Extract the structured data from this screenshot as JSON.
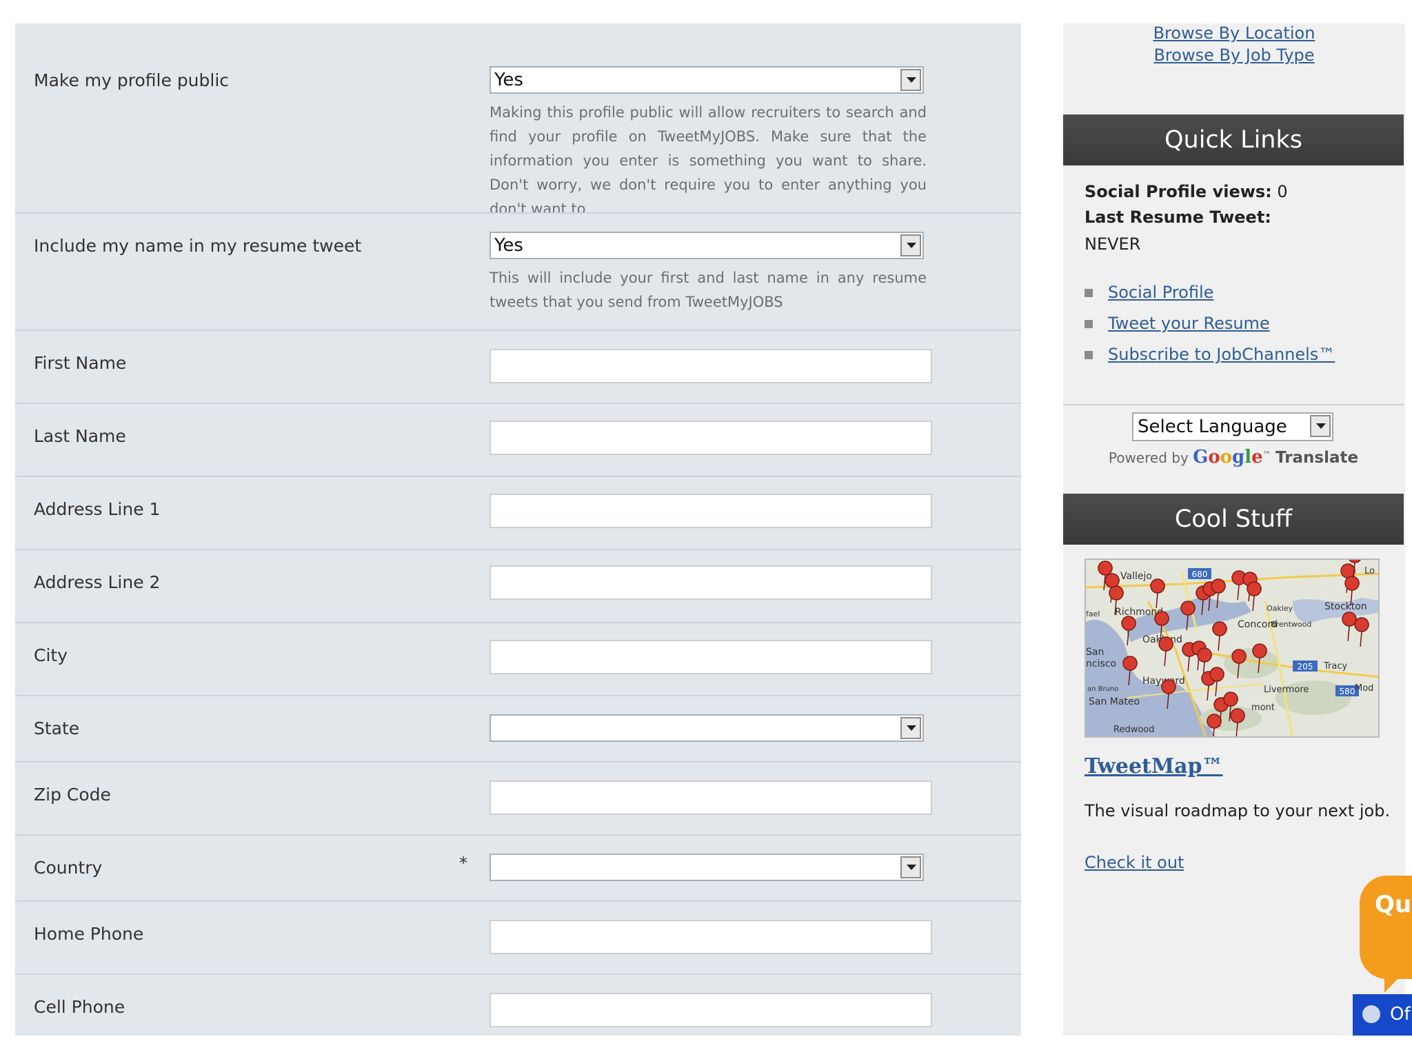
{
  "form": {
    "profile_public": {
      "label": "Make my profile public",
      "value": "Yes",
      "help": "Making this profile public will allow recruiters to search and find your profile on TweetMyJOBS. Make sure that the information you enter is something you want to share. Don't worry, we don't require you to enter anything you don't want to"
    },
    "include_name": {
      "label": "Include my name in my resume tweet",
      "value": "Yes",
      "help": "This will include your first and last name in any resume tweets that you send from TweetMyJOBS"
    },
    "first_name": {
      "label": "First Name",
      "value": ""
    },
    "last_name": {
      "label": "Last Name",
      "value": ""
    },
    "address1": {
      "label": "Address Line 1",
      "value": ""
    },
    "address2": {
      "label": "Address Line 2",
      "value": ""
    },
    "city": {
      "label": "City",
      "value": ""
    },
    "state": {
      "label": "State",
      "value": ""
    },
    "zip": {
      "label": "Zip Code",
      "value": ""
    },
    "country": {
      "label": "Country",
      "required_mark": "*",
      "value": ""
    },
    "home_phone": {
      "label": "Home Phone",
      "value": ""
    },
    "cell_phone": {
      "label": "Cell Phone",
      "value": ""
    }
  },
  "sidebar": {
    "browse_location": "Browse By Location",
    "browse_job_type": "Browse By Job Type",
    "quick_links": {
      "header": "Quick Links",
      "views_label": "Social Profile views:",
      "views_value": "0",
      "last_tweet_label": "Last Resume Tweet:",
      "last_tweet_value": "NEVER",
      "links": [
        "Social Profile",
        "Tweet your Resume",
        "Subscribe to JobChannels™"
      ]
    },
    "translate": {
      "select_value": "Select Language",
      "powered_by": "Powered by",
      "google": [
        "G",
        "o",
        "o",
        "g",
        "l",
        "e"
      ],
      "tm": "™",
      "translate_word": "Translate"
    },
    "cool_stuff": {
      "header": "Cool Stuff",
      "map_places": [
        "Vallejo",
        "Richmond",
        "Concord",
        "Oakland",
        "San",
        "ncisco",
        "Hayward",
        "San Mateo",
        "Redwood",
        "Livermore",
        "Tracy",
        "Stockton",
        "Oakley",
        "Brentwood",
        "Mod",
        "mont",
        "an Bruno",
        "fael",
        "Lo",
        "680",
        "205",
        "580"
      ],
      "title": "TweetMap™",
      "description": "The visual roadmap to your next job.",
      "link": "Check it out"
    }
  },
  "widgets": {
    "feedback_label": "Qu",
    "online_label": "Of"
  },
  "colors": {
    "form_bg": "#e1e7eb",
    "sidebar_bg": "#f0f0f0",
    "header_bg": "#444444",
    "link": "#2f5d99",
    "feedback": "#f39c1e",
    "online_tab": "#1649c9"
  }
}
